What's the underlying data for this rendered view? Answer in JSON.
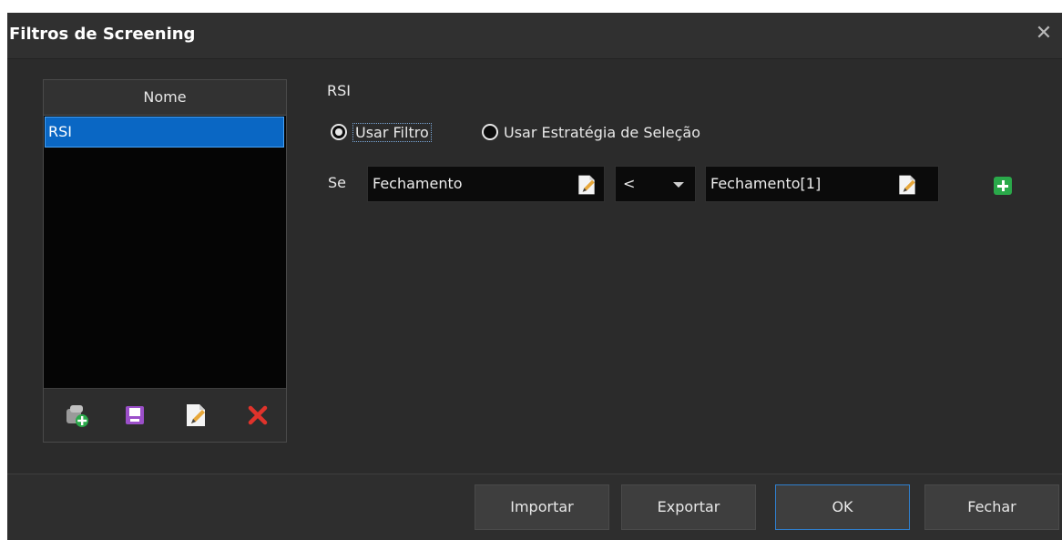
{
  "window": {
    "title": "Filtros de Screening"
  },
  "list": {
    "header": "Nome",
    "items": [
      {
        "label": "RSI",
        "selected": true
      }
    ],
    "toolbar": [
      "add-filter-icon",
      "save-icon",
      "edit-icon",
      "delete-icon"
    ]
  },
  "editor": {
    "filter_name": "RSI",
    "mode_options": {
      "use_filter": "Usar Filtro",
      "use_strategy": "Usar Estratégia de Seleção"
    },
    "selected_mode": "use_filter",
    "condition": {
      "if_label": "Se",
      "left_operand": "Fechamento",
      "operator": "<",
      "right_operand": "Fechamento[1]"
    }
  },
  "buttons": {
    "import": "Importar",
    "export": "Exportar",
    "ok": "OK",
    "close": "Fechar"
  },
  "colors": {
    "background": "#2b2b2b",
    "selection": "#0a67c4",
    "add": "#2aa94a",
    "delete": "#e0332b"
  }
}
